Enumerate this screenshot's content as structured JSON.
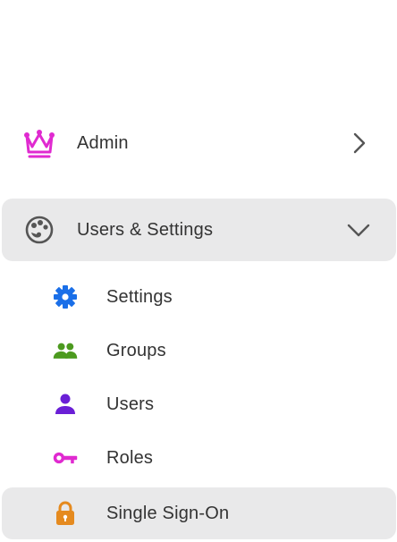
{
  "nav": {
    "admin": {
      "label": "Admin",
      "icon": "crown-icon",
      "color": "#e02ad0"
    },
    "users_settings": {
      "label": "Users & Settings",
      "icon": "palette-icon",
      "color": "#555555",
      "expanded": true
    },
    "children": [
      {
        "label": "Settings",
        "icon": "gear-icon",
        "color": "#1a6fe8"
      },
      {
        "label": "Groups",
        "icon": "group-icon",
        "color": "#4c9a1f"
      },
      {
        "label": "Users",
        "icon": "user-icon",
        "color": "#6a1fd6"
      },
      {
        "label": "Roles",
        "icon": "key-icon",
        "color": "#e02ad0"
      },
      {
        "label": "Single Sign-On",
        "icon": "lock-icon",
        "color": "#e58a1f",
        "selected": true
      }
    ]
  },
  "colors": {
    "highlight_bg": "#e9e9ea",
    "text": "#333333",
    "chevron": "#555555"
  }
}
